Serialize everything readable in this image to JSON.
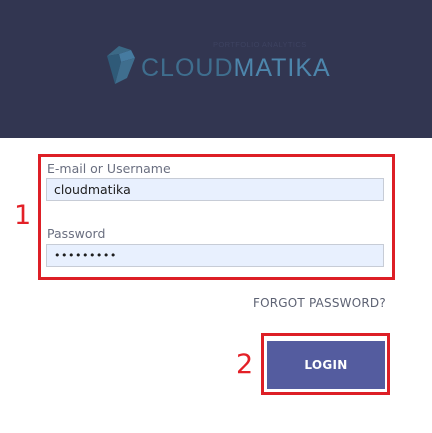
{
  "header": {
    "logo": {
      "tagline": "PORTFOLIO ANALYTICS",
      "brand_part1": "CLOUD",
      "brand_part2": "MATIKA",
      "icon": "bird-logo-icon"
    }
  },
  "login_form": {
    "username_label": "E-mail or Username",
    "username_value": "cloudmatika",
    "password_label": "Password",
    "password_value": "•••••••••",
    "forgot_password": "FORGOT PASSWORD?",
    "login_button": "LOGIN"
  },
  "annotations": {
    "marker_1": "1",
    "marker_2": "2",
    "highlight_color": "#dd1f26"
  },
  "colors": {
    "header_bg": "#323651",
    "button_bg": "#545c9f",
    "input_bg": "#e8f0fe"
  }
}
